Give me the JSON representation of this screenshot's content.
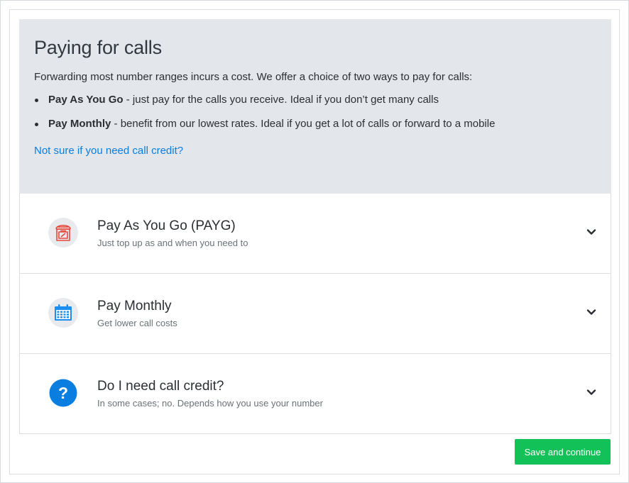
{
  "intro": {
    "title": "Paying for calls",
    "description": "Forwarding most number ranges incurs a cost. We offer a choice of two ways to pay for calls:",
    "bullets": [
      {
        "bold": "Pay As You Go",
        "text": " - just pay for the calls you receive. Ideal if you don’t get many calls"
      },
      {
        "bold": "Pay Monthly",
        "text": " - benefit from our lowest rates. Ideal if you get a lot of calls or forward to a mobile"
      }
    ],
    "help_link": "Not sure if you need call credit?"
  },
  "accordion": {
    "items": [
      {
        "icon": "payg-meter-icon",
        "title": "Pay As You Go (PAYG)",
        "subtitle": "Just top up as and when you need to"
      },
      {
        "icon": "calendar-icon",
        "title": "Pay Monthly",
        "subtitle": "Get lower call costs"
      },
      {
        "icon": "question-icon",
        "title": "Do I need call credit?",
        "subtitle": "In some cases; no. Depends how you use your number"
      }
    ]
  },
  "actions": {
    "save_label": "Save and continue"
  },
  "colors": {
    "accent_link": "#0a7de0",
    "save_button": "#12c259",
    "intro_background": "#e3e6ea",
    "payg_icon": "#e8483b",
    "calendar_icon": "#1c8ef0",
    "question_icon": "#0a7de0"
  }
}
